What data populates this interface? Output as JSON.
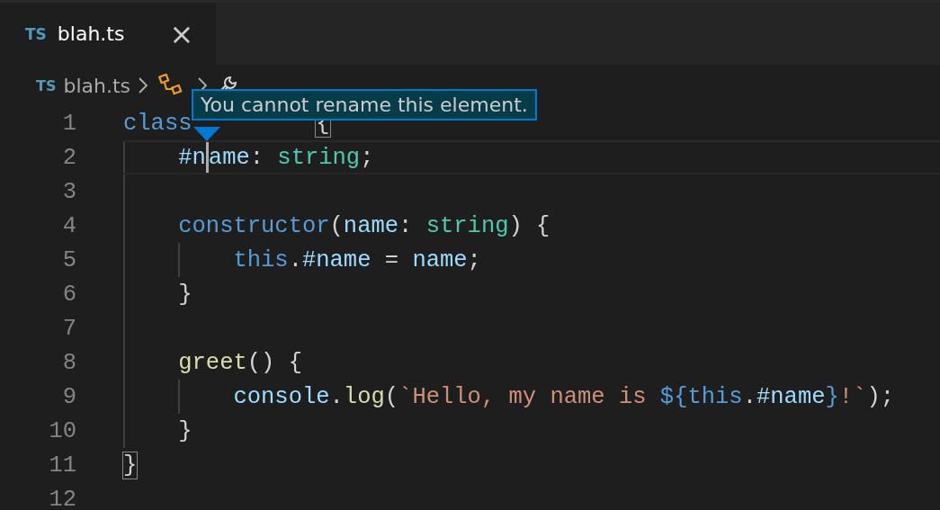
{
  "tabs": [
    {
      "icon_label": "TS",
      "label": "blah.ts",
      "close": "×",
      "selected": true
    }
  ],
  "breadcrumbs": [
    {
      "kind": "file",
      "icon_label": "TS",
      "label": "blah.ts"
    },
    {
      "kind": "class"
    },
    {
      "kind": "property"
    }
  ],
  "tooltip": {
    "text": "You cannot rename this element."
  },
  "lines": [
    {
      "number": "1",
      "tokens": [
        {
          "text": "class",
          "kind": "keyword"
        },
        {
          "text": "         {",
          "kind": "punct",
          "match": true
        }
      ]
    },
    {
      "number": "2",
      "current": true,
      "tokens": [
        {
          "text": "    #n",
          "kind": "property",
          "caret": true
        },
        {
          "text": "ame",
          "kind": "property"
        },
        {
          "text": ": ",
          "kind": "punct"
        },
        {
          "text": "string",
          "kind": "type"
        },
        {
          "text": ";",
          "kind": "punct"
        }
      ]
    },
    {
      "number": "3"
    },
    {
      "number": "4",
      "tokens": [
        {
          "text": "    constructor",
          "kind": "keyword"
        },
        {
          "text": "(",
          "kind": "punct"
        },
        {
          "text": "name",
          "kind": "property"
        },
        {
          "text": ": ",
          "kind": "punct"
        },
        {
          "text": "string",
          "kind": "type"
        },
        {
          "text": ") {",
          "kind": "punct"
        }
      ]
    },
    {
      "number": "5",
      "tokens": [
        {
          "text": "        this",
          "kind": "keyword"
        },
        {
          "text": ".",
          "kind": "punct"
        },
        {
          "text": "#name",
          "kind": "property"
        },
        {
          "text": " = ",
          "kind": "punct"
        },
        {
          "text": "name",
          "kind": "property"
        },
        {
          "text": ";",
          "kind": "punct"
        }
      ]
    },
    {
      "number": "6",
      "tokens": [
        {
          "text": "    }",
          "kind": "punct"
        }
      ]
    },
    {
      "number": "7"
    },
    {
      "number": "8",
      "tokens": [
        {
          "text": "    greet",
          "kind": "function"
        },
        {
          "text": "() {",
          "kind": "punct"
        }
      ]
    },
    {
      "number": "9",
      "tokens": [
        {
          "text": "        console",
          "kind": "property"
        },
        {
          "text": ".",
          "kind": "punct"
        },
        {
          "text": "log",
          "kind": "function"
        },
        {
          "text": "(",
          "kind": "punct"
        },
        {
          "text": "`Hello, my name is ",
          "kind": "string"
        },
        {
          "text": "${",
          "kind": "keyword"
        },
        {
          "text": "this",
          "kind": "keyword"
        },
        {
          "text": ".",
          "kind": "punct"
        },
        {
          "text": "#name",
          "kind": "property"
        },
        {
          "text": "}",
          "kind": "keyword"
        },
        {
          "text": "!`",
          "kind": "string"
        },
        {
          "text": ");",
          "kind": "punct"
        }
      ]
    },
    {
      "number": "10",
      "tokens": [
        {
          "text": "    }",
          "kind": "punct"
        }
      ]
    },
    {
      "number": "11",
      "tokens": [
        {
          "text": "}",
          "kind": "punct",
          "match": true
        }
      ]
    },
    {
      "number": "12"
    }
  ]
}
